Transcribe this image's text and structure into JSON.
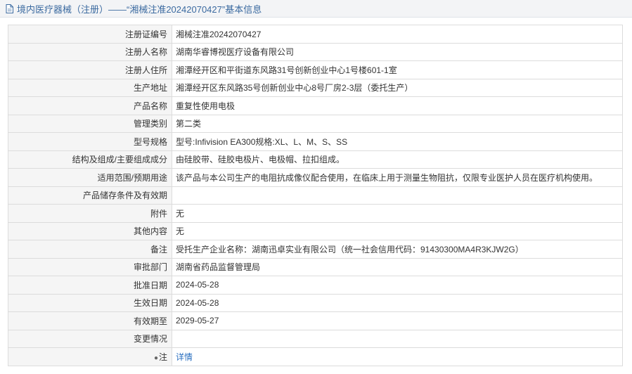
{
  "header": {
    "title": "境内医疗器械（注册）——“湘械注准20242070427”基本信息"
  },
  "rows": [
    {
      "label": "注册证编号",
      "value": "湘械注准20242070427"
    },
    {
      "label": "注册人名称",
      "value": "湖南华睿博视医疗设备有限公司"
    },
    {
      "label": "注册人住所",
      "value": "湘潭经开区和平街道东风路31号创新创业中心1号楼601-1室"
    },
    {
      "label": "生产地址",
      "value": "湘潭经开区东风路35号创新创业中心8号厂房2-3层（委托生产）"
    },
    {
      "label": "产品名称",
      "value": "重复性使用电极"
    },
    {
      "label": "管理类别",
      "value": "第二类"
    },
    {
      "label": "型号规格",
      "value": "型号:Infivision EA300规格:XL、L、M、S、SS"
    },
    {
      "label": "结构及组成/主要组成成分",
      "value": "由硅胶带、硅胶电极片、电极帽、拉扣组成。"
    },
    {
      "label": "适用范围/预期用途",
      "value": "该产品与本公司生产的电阻抗成像仪配合使用，在临床上用于测量生物阻抗，仅限专业医护人员在医疗机构使用。"
    },
    {
      "label": "产品储存条件及有效期",
      "value": ""
    },
    {
      "label": "附件",
      "value": "无"
    },
    {
      "label": "其他内容",
      "value": "无"
    },
    {
      "label": "备注",
      "value": "受托生产企业名称：湖南迅卓实业有限公司（统一社会信用代码：91430300MA4R3KJW2G）"
    },
    {
      "label": "审批部门",
      "value": "湖南省药品监督管理局"
    },
    {
      "label": "批准日期",
      "value": "2024-05-28"
    },
    {
      "label": "生效日期",
      "value": "2024-05-28"
    },
    {
      "label": "有效期至",
      "value": "2029-05-27"
    },
    {
      "label": "变更情况",
      "value": ""
    }
  ],
  "note": {
    "label": "注",
    "icon": "pin-icon",
    "link_text": "详情",
    "link_color": "#2a6fc0"
  }
}
